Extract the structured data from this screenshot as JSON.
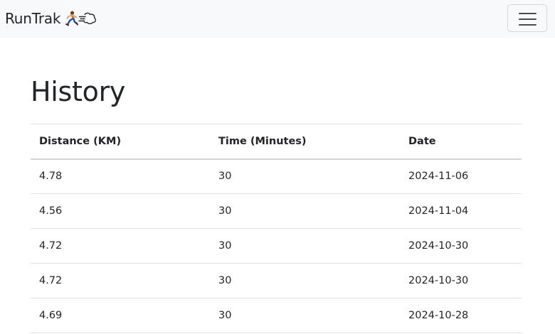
{
  "navbar": {
    "brand": "RunTrak",
    "brand_icons": [
      "runner-icon",
      "dash-cloud-icon"
    ],
    "toggler_icon": "hamburger-menu-icon"
  },
  "main": {
    "title": "History",
    "table": {
      "headers": [
        "Distance (KM)",
        "Time (Minutes)",
        "Date"
      ],
      "rows": [
        [
          "4.78",
          "30",
          "2024-11-06"
        ],
        [
          "4.56",
          "30",
          "2024-11-04"
        ],
        [
          "4.72",
          "30",
          "2024-10-30"
        ],
        [
          "4.72",
          "30",
          "2024-10-30"
        ],
        [
          "4.69",
          "30",
          "2024-10-28"
        ]
      ]
    }
  },
  "colors": {
    "navbar_bg": "#f8f9fa",
    "text": "#212529",
    "border": "#dee2e6"
  }
}
